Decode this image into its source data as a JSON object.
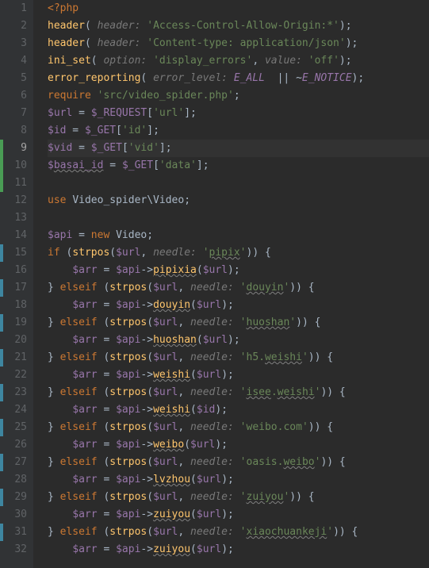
{
  "lines": [
    {
      "n": 1,
      "marker": null,
      "current": false,
      "tokens": [
        {
          "c": "tag",
          "t": "<?php"
        }
      ]
    },
    {
      "n": 2,
      "marker": null,
      "current": false,
      "tokens": [
        {
          "c": "fn",
          "t": "header"
        },
        {
          "c": "punct",
          "t": "( "
        },
        {
          "c": "hint",
          "t": "header: "
        },
        {
          "c": "str",
          "t": "'Access-Control-Allow-Origin:*'"
        },
        {
          "c": "punct",
          "t": ");"
        }
      ]
    },
    {
      "n": 3,
      "marker": null,
      "current": false,
      "tokens": [
        {
          "c": "fn",
          "t": "header"
        },
        {
          "c": "punct",
          "t": "( "
        },
        {
          "c": "hint",
          "t": "header: "
        },
        {
          "c": "str",
          "t": "'Content-type: application/json'"
        },
        {
          "c": "punct",
          "t": ");"
        }
      ]
    },
    {
      "n": 4,
      "marker": null,
      "current": false,
      "tokens": [
        {
          "c": "fn",
          "t": "ini_set"
        },
        {
          "c": "punct",
          "t": "( "
        },
        {
          "c": "hint",
          "t": "option: "
        },
        {
          "c": "str",
          "t": "'display_errors'"
        },
        {
          "c": "punct",
          "t": ", "
        },
        {
          "c": "hint",
          "t": "value: "
        },
        {
          "c": "str",
          "t": "'off'"
        },
        {
          "c": "punct",
          "t": ");"
        }
      ]
    },
    {
      "n": 5,
      "marker": null,
      "current": false,
      "tokens": [
        {
          "c": "fn",
          "t": "error_reporting"
        },
        {
          "c": "punct",
          "t": "( "
        },
        {
          "c": "hint",
          "t": "error_level: "
        },
        {
          "c": "const",
          "t": "E_ALL "
        },
        {
          "c": "punct",
          "t": " || ~"
        },
        {
          "c": "const",
          "t": "E_NOTICE"
        },
        {
          "c": "punct",
          "t": ");"
        }
      ]
    },
    {
      "n": 6,
      "marker": null,
      "current": false,
      "tokens": [
        {
          "c": "kw",
          "t": "require "
        },
        {
          "c": "str",
          "t": "'src/video_spider.php'"
        },
        {
          "c": "punct",
          "t": ";"
        }
      ]
    },
    {
      "n": 7,
      "marker": null,
      "current": false,
      "tokens": [
        {
          "c": "var",
          "t": "$url"
        },
        {
          "c": "punct",
          "t": " = "
        },
        {
          "c": "var",
          "t": "$_REQUEST"
        },
        {
          "c": "punct",
          "t": "["
        },
        {
          "c": "str",
          "t": "'url'"
        },
        {
          "c": "punct",
          "t": "];"
        }
      ]
    },
    {
      "n": 8,
      "marker": null,
      "current": false,
      "tokens": [
        {
          "c": "var",
          "t": "$id"
        },
        {
          "c": "punct",
          "t": " = "
        },
        {
          "c": "var",
          "t": "$_GET"
        },
        {
          "c": "punct",
          "t": "["
        },
        {
          "c": "str",
          "t": "'id'"
        },
        {
          "c": "punct",
          "t": "];"
        }
      ]
    },
    {
      "n": 9,
      "marker": "green",
      "current": true,
      "tokens": [
        {
          "c": "var",
          "t": "$vid"
        },
        {
          "c": "punct",
          "t": " = "
        },
        {
          "c": "var",
          "t": "$_GET"
        },
        {
          "c": "punct",
          "t": "["
        },
        {
          "c": "str",
          "t": "'vid'"
        },
        {
          "c": "punct",
          "t": "];"
        }
      ]
    },
    {
      "n": 10,
      "marker": "green",
      "current": false,
      "tokens": [
        {
          "c": "var",
          "t": "$"
        },
        {
          "c": "var wavy",
          "t": "basai_id"
        },
        {
          "c": "punct",
          "t": " = "
        },
        {
          "c": "var",
          "t": "$_GET"
        },
        {
          "c": "punct",
          "t": "["
        },
        {
          "c": "str",
          "t": "'data'"
        },
        {
          "c": "punct",
          "t": "];"
        }
      ]
    },
    {
      "n": 11,
      "marker": "green",
      "current": false,
      "tokens": []
    },
    {
      "n": 12,
      "marker": null,
      "current": false,
      "tokens": [
        {
          "c": "kw",
          "t": "use "
        },
        {
          "c": "punct",
          "t": "Video_spider\\Video;"
        }
      ]
    },
    {
      "n": 13,
      "marker": null,
      "current": false,
      "tokens": []
    },
    {
      "n": 14,
      "marker": null,
      "current": false,
      "tokens": [
        {
          "c": "var",
          "t": "$api"
        },
        {
          "c": "punct",
          "t": " = "
        },
        {
          "c": "kw",
          "t": "new "
        },
        {
          "c": "punct",
          "t": "Video;"
        }
      ]
    },
    {
      "n": 15,
      "marker": "blue",
      "current": false,
      "tokens": [
        {
          "c": "kw",
          "t": "if "
        },
        {
          "c": "punct",
          "t": "("
        },
        {
          "c": "fn",
          "t": "strpos"
        },
        {
          "c": "punct",
          "t": "("
        },
        {
          "c": "var",
          "t": "$url"
        },
        {
          "c": "punct",
          "t": ", "
        },
        {
          "c": "hint",
          "t": "needle: "
        },
        {
          "c": "str",
          "t": "'"
        },
        {
          "c": "str wavy",
          "t": "pipix"
        },
        {
          "c": "str",
          "t": "'"
        },
        {
          "c": "punct",
          "t": ")) {"
        }
      ]
    },
    {
      "n": 16,
      "marker": null,
      "current": false,
      "tokens": [
        {
          "c": "punct",
          "t": "    "
        },
        {
          "c": "var",
          "t": "$arr"
        },
        {
          "c": "punct",
          "t": " = "
        },
        {
          "c": "var",
          "t": "$api"
        },
        {
          "c": "punct",
          "t": "->"
        },
        {
          "c": "fn wavy",
          "t": "pipixia"
        },
        {
          "c": "punct",
          "t": "("
        },
        {
          "c": "var",
          "t": "$url"
        },
        {
          "c": "punct",
          "t": ");"
        }
      ]
    },
    {
      "n": 17,
      "marker": "blue",
      "current": false,
      "tokens": [
        {
          "c": "punct",
          "t": "} "
        },
        {
          "c": "kw",
          "t": "elseif "
        },
        {
          "c": "punct",
          "t": "("
        },
        {
          "c": "fn",
          "t": "strpos"
        },
        {
          "c": "punct",
          "t": "("
        },
        {
          "c": "var",
          "t": "$url"
        },
        {
          "c": "punct",
          "t": ", "
        },
        {
          "c": "hint",
          "t": "needle: "
        },
        {
          "c": "str",
          "t": "'"
        },
        {
          "c": "str wavy",
          "t": "douyin"
        },
        {
          "c": "str",
          "t": "'"
        },
        {
          "c": "punct",
          "t": ")) {"
        }
      ]
    },
    {
      "n": 18,
      "marker": null,
      "current": false,
      "tokens": [
        {
          "c": "punct",
          "t": "    "
        },
        {
          "c": "var",
          "t": "$arr"
        },
        {
          "c": "punct",
          "t": " = "
        },
        {
          "c": "var",
          "t": "$api"
        },
        {
          "c": "punct",
          "t": "->"
        },
        {
          "c": "fn wavy",
          "t": "douyin"
        },
        {
          "c": "punct",
          "t": "("
        },
        {
          "c": "var",
          "t": "$url"
        },
        {
          "c": "punct",
          "t": ");"
        }
      ]
    },
    {
      "n": 19,
      "marker": "blue",
      "current": false,
      "tokens": [
        {
          "c": "punct",
          "t": "} "
        },
        {
          "c": "kw",
          "t": "elseif "
        },
        {
          "c": "punct",
          "t": "("
        },
        {
          "c": "fn",
          "t": "strpos"
        },
        {
          "c": "punct",
          "t": "("
        },
        {
          "c": "var",
          "t": "$url"
        },
        {
          "c": "punct",
          "t": ", "
        },
        {
          "c": "hint",
          "t": "needle: "
        },
        {
          "c": "str",
          "t": "'"
        },
        {
          "c": "str wavy",
          "t": "huoshan"
        },
        {
          "c": "str",
          "t": "'"
        },
        {
          "c": "punct",
          "t": ")) {"
        }
      ]
    },
    {
      "n": 20,
      "marker": null,
      "current": false,
      "tokens": [
        {
          "c": "punct",
          "t": "    "
        },
        {
          "c": "var",
          "t": "$arr"
        },
        {
          "c": "punct",
          "t": " = "
        },
        {
          "c": "var",
          "t": "$api"
        },
        {
          "c": "punct",
          "t": "->"
        },
        {
          "c": "fn wavy",
          "t": "huoshan"
        },
        {
          "c": "punct",
          "t": "("
        },
        {
          "c": "var",
          "t": "$url"
        },
        {
          "c": "punct",
          "t": ");"
        }
      ]
    },
    {
      "n": 21,
      "marker": "blue",
      "current": false,
      "tokens": [
        {
          "c": "punct",
          "t": "} "
        },
        {
          "c": "kw",
          "t": "elseif "
        },
        {
          "c": "punct",
          "t": "("
        },
        {
          "c": "fn",
          "t": "strpos"
        },
        {
          "c": "punct",
          "t": "("
        },
        {
          "c": "var",
          "t": "$url"
        },
        {
          "c": "punct",
          "t": ", "
        },
        {
          "c": "hint",
          "t": "needle: "
        },
        {
          "c": "str",
          "t": "'h5."
        },
        {
          "c": "str wavy",
          "t": "weishi"
        },
        {
          "c": "str",
          "t": "'"
        },
        {
          "c": "punct",
          "t": ")) {"
        }
      ]
    },
    {
      "n": 22,
      "marker": null,
      "current": false,
      "tokens": [
        {
          "c": "punct",
          "t": "    "
        },
        {
          "c": "var",
          "t": "$arr"
        },
        {
          "c": "punct",
          "t": " = "
        },
        {
          "c": "var",
          "t": "$api"
        },
        {
          "c": "punct",
          "t": "->"
        },
        {
          "c": "fn wavy",
          "t": "weishi"
        },
        {
          "c": "punct",
          "t": "("
        },
        {
          "c": "var",
          "t": "$url"
        },
        {
          "c": "punct",
          "t": ");"
        }
      ]
    },
    {
      "n": 23,
      "marker": "blue",
      "current": false,
      "tokens": [
        {
          "c": "punct",
          "t": "} "
        },
        {
          "c": "kw",
          "t": "elseif "
        },
        {
          "c": "punct",
          "t": "("
        },
        {
          "c": "fn",
          "t": "strpos"
        },
        {
          "c": "punct",
          "t": "("
        },
        {
          "c": "var",
          "t": "$url"
        },
        {
          "c": "punct",
          "t": ", "
        },
        {
          "c": "hint",
          "t": "needle: "
        },
        {
          "c": "str",
          "t": "'"
        },
        {
          "c": "str wavy",
          "t": "isee"
        },
        {
          "c": "str",
          "t": "."
        },
        {
          "c": "str wavy",
          "t": "weishi"
        },
        {
          "c": "str",
          "t": "'"
        },
        {
          "c": "punct",
          "t": ")) {"
        }
      ]
    },
    {
      "n": 24,
      "marker": null,
      "current": false,
      "tokens": [
        {
          "c": "punct",
          "t": "    "
        },
        {
          "c": "var",
          "t": "$arr"
        },
        {
          "c": "punct",
          "t": " = "
        },
        {
          "c": "var",
          "t": "$api"
        },
        {
          "c": "punct",
          "t": "->"
        },
        {
          "c": "fn wavy",
          "t": "weishi"
        },
        {
          "c": "punct",
          "t": "("
        },
        {
          "c": "var",
          "t": "$id"
        },
        {
          "c": "punct",
          "t": ");"
        }
      ]
    },
    {
      "n": 25,
      "marker": "blue",
      "current": false,
      "tokens": [
        {
          "c": "punct",
          "t": "} "
        },
        {
          "c": "kw",
          "t": "elseif "
        },
        {
          "c": "punct",
          "t": "("
        },
        {
          "c": "fn",
          "t": "strpos"
        },
        {
          "c": "punct",
          "t": "("
        },
        {
          "c": "var",
          "t": "$url"
        },
        {
          "c": "punct",
          "t": ", "
        },
        {
          "c": "hint",
          "t": "needle: "
        },
        {
          "c": "str",
          "t": "'weibo.com'"
        },
        {
          "c": "punct",
          "t": ")) {"
        }
      ]
    },
    {
      "n": 26,
      "marker": null,
      "current": false,
      "tokens": [
        {
          "c": "punct",
          "t": "    "
        },
        {
          "c": "var",
          "t": "$arr"
        },
        {
          "c": "punct",
          "t": " = "
        },
        {
          "c": "var",
          "t": "$api"
        },
        {
          "c": "punct",
          "t": "->"
        },
        {
          "c": "fn wavy",
          "t": "weibo"
        },
        {
          "c": "punct",
          "t": "("
        },
        {
          "c": "var",
          "t": "$url"
        },
        {
          "c": "punct",
          "t": ");"
        }
      ]
    },
    {
      "n": 27,
      "marker": "blue",
      "current": false,
      "tokens": [
        {
          "c": "punct",
          "t": "} "
        },
        {
          "c": "kw",
          "t": "elseif "
        },
        {
          "c": "punct",
          "t": "("
        },
        {
          "c": "fn",
          "t": "strpos"
        },
        {
          "c": "punct",
          "t": "("
        },
        {
          "c": "var",
          "t": "$url"
        },
        {
          "c": "punct",
          "t": ", "
        },
        {
          "c": "hint",
          "t": "needle: "
        },
        {
          "c": "str",
          "t": "'oasis."
        },
        {
          "c": "str wavy",
          "t": "weibo"
        },
        {
          "c": "str",
          "t": "'"
        },
        {
          "c": "punct",
          "t": ")) {"
        }
      ]
    },
    {
      "n": 28,
      "marker": null,
      "current": false,
      "tokens": [
        {
          "c": "punct",
          "t": "    "
        },
        {
          "c": "var",
          "t": "$arr"
        },
        {
          "c": "punct",
          "t": " = "
        },
        {
          "c": "var",
          "t": "$api"
        },
        {
          "c": "punct",
          "t": "->"
        },
        {
          "c": "fn wavy",
          "t": "lvzhou"
        },
        {
          "c": "punct",
          "t": "("
        },
        {
          "c": "var",
          "t": "$url"
        },
        {
          "c": "punct",
          "t": ");"
        }
      ]
    },
    {
      "n": 29,
      "marker": "blue",
      "current": false,
      "tokens": [
        {
          "c": "punct",
          "t": "} "
        },
        {
          "c": "kw",
          "t": "elseif "
        },
        {
          "c": "punct",
          "t": "("
        },
        {
          "c": "fn",
          "t": "strpos"
        },
        {
          "c": "punct",
          "t": "("
        },
        {
          "c": "var",
          "t": "$url"
        },
        {
          "c": "punct",
          "t": ", "
        },
        {
          "c": "hint",
          "t": "needle: "
        },
        {
          "c": "str",
          "t": "'"
        },
        {
          "c": "str wavy",
          "t": "zuiyou"
        },
        {
          "c": "str",
          "t": "'"
        },
        {
          "c": "punct",
          "t": ")) {"
        }
      ]
    },
    {
      "n": 30,
      "marker": null,
      "current": false,
      "tokens": [
        {
          "c": "punct",
          "t": "    "
        },
        {
          "c": "var",
          "t": "$arr"
        },
        {
          "c": "punct",
          "t": " = "
        },
        {
          "c": "var",
          "t": "$api"
        },
        {
          "c": "punct",
          "t": "->"
        },
        {
          "c": "fn wavy",
          "t": "zuiyou"
        },
        {
          "c": "punct",
          "t": "("
        },
        {
          "c": "var",
          "t": "$url"
        },
        {
          "c": "punct",
          "t": ");"
        }
      ]
    },
    {
      "n": 31,
      "marker": "blue",
      "current": false,
      "tokens": [
        {
          "c": "punct",
          "t": "} "
        },
        {
          "c": "kw",
          "t": "elseif "
        },
        {
          "c": "punct",
          "t": "("
        },
        {
          "c": "fn",
          "t": "strpos"
        },
        {
          "c": "punct",
          "t": "("
        },
        {
          "c": "var",
          "t": "$url"
        },
        {
          "c": "punct",
          "t": ", "
        },
        {
          "c": "hint",
          "t": "needle: "
        },
        {
          "c": "str",
          "t": "'"
        },
        {
          "c": "str wavy",
          "t": "xiaochuankeji"
        },
        {
          "c": "str",
          "t": "'"
        },
        {
          "c": "punct",
          "t": ")) {"
        }
      ]
    },
    {
      "n": 32,
      "marker": null,
      "current": false,
      "tokens": [
        {
          "c": "punct",
          "t": "    "
        },
        {
          "c": "var",
          "t": "$arr"
        },
        {
          "c": "punct",
          "t": " = "
        },
        {
          "c": "var",
          "t": "$api"
        },
        {
          "c": "punct",
          "t": "->"
        },
        {
          "c": "fn wavy",
          "t": "zuiyou"
        },
        {
          "c": "punct",
          "t": "("
        },
        {
          "c": "var",
          "t": "$url"
        },
        {
          "c": "punct",
          "t": ");"
        }
      ]
    }
  ]
}
